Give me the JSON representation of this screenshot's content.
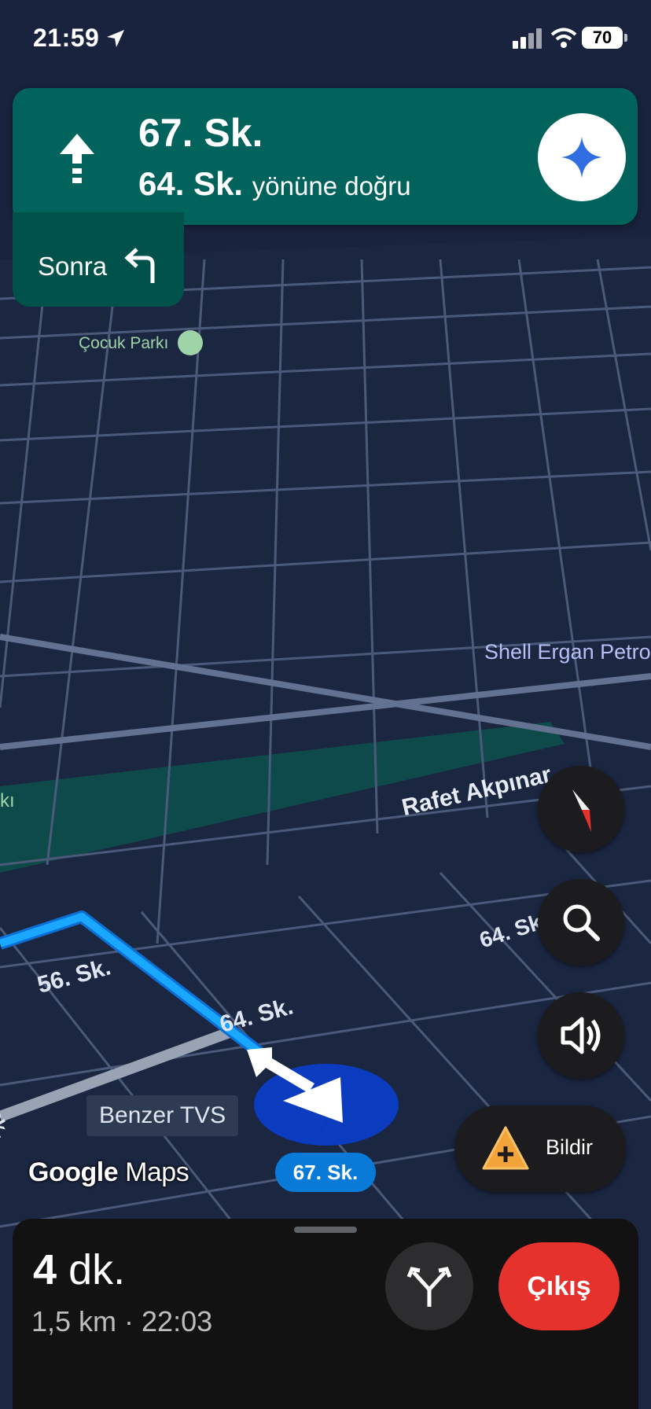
{
  "status_bar": {
    "time": "21:59",
    "battery": "70"
  },
  "navigation": {
    "current_street": "67. Sk.",
    "towards_street": "64. Sk.",
    "towards_suffix": "yönüne doğru",
    "then_label": "Sonra",
    "then_turn": "turn-left",
    "current_turn": "straight"
  },
  "map": {
    "labels": {
      "park": "Çocuk Parkı",
      "shell": "Shell Ergan Petro",
      "rafet": "Rafet Akpınar",
      "ki": "kı",
      "sk64_right": "64. Sk.",
      "sk56": "56. Sk.",
      "sk64_route": "64. Sk.",
      "sk_left": "Sk.",
      "poi": "Benzer TVS"
    },
    "current_street_pill": "67. Sk.",
    "logo": {
      "google": "Google",
      "maps": "Maps"
    },
    "route_color": "#1aa7ff",
    "map_bg": "#19233d",
    "road_color": "#54647e"
  },
  "controls": {
    "compass": "compass-icon",
    "search": "search-icon",
    "sound": "volume-icon",
    "report_label": "Bildir"
  },
  "trip": {
    "duration_value": "4",
    "duration_unit": "dk.",
    "distance_eta": "1,5 km · 22:03",
    "exit_label": "Çıkış",
    "routes_icon": "alt-routes-icon"
  },
  "colors": {
    "nav_card": "#01635b",
    "exit_button": "#e5322c",
    "street_pill": "#0a7ad9"
  }
}
